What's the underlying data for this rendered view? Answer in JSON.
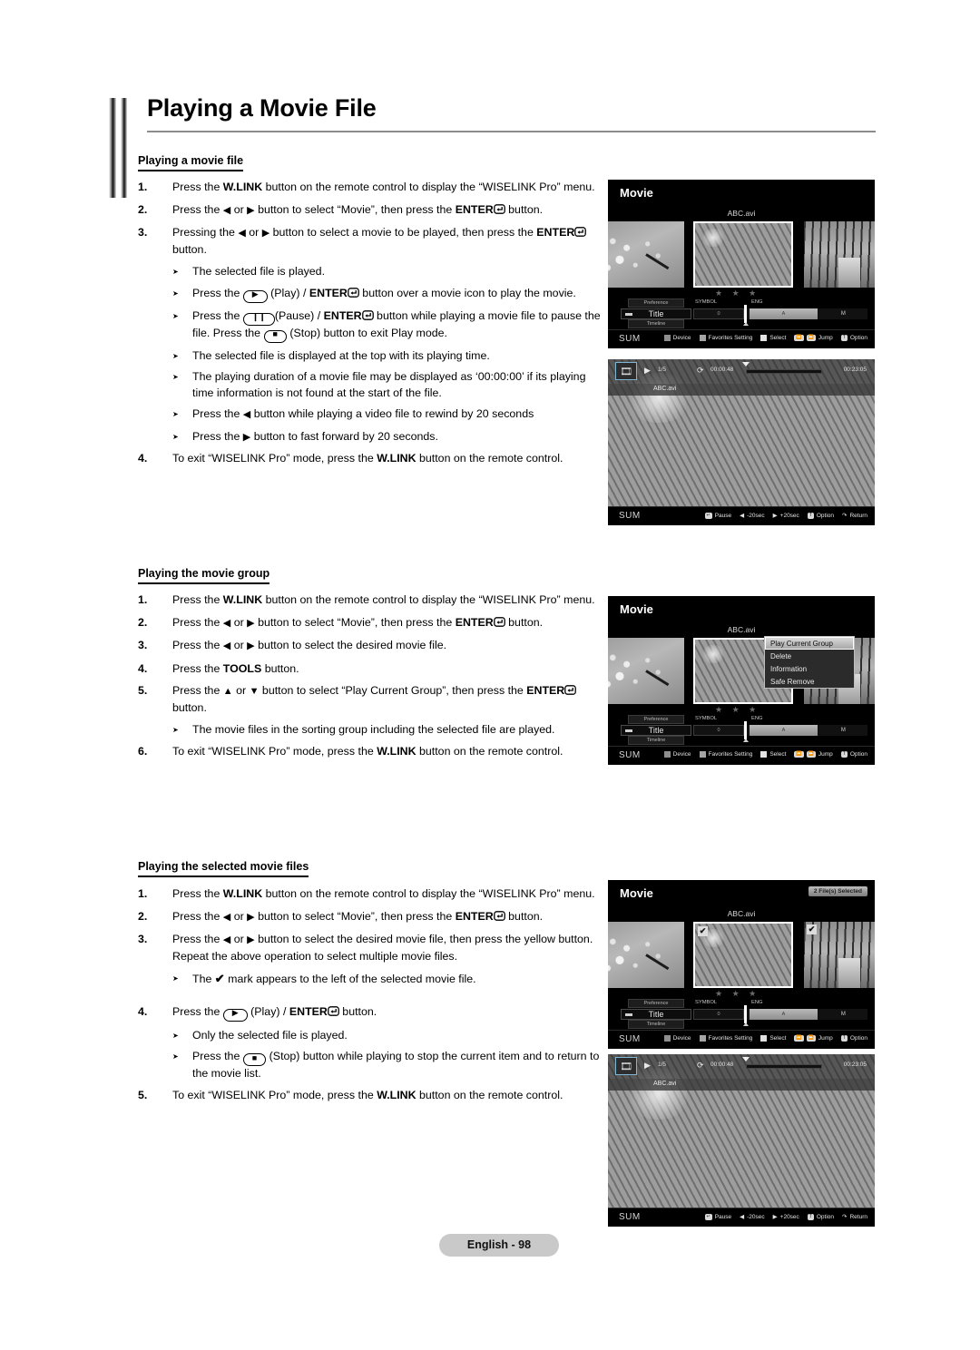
{
  "page": {
    "title": "Playing a Movie File",
    "footer_label": "English - 98"
  },
  "sections": [
    {
      "heading": "Playing a movie file",
      "steps": [
        {
          "num": "1.",
          "parts": [
            {
              "t": "Press the "
            },
            {
              "t": "W.LINK",
              "b": true
            },
            {
              "t": " button on the remote control to display the “WISELINK Pro” menu."
            }
          ]
        },
        {
          "num": "2.",
          "parts": [
            {
              "t": "Press the "
            },
            {
              "t": "◀",
              "tri": true
            },
            {
              "t": " or "
            },
            {
              "t": "▶",
              "tri": true
            },
            {
              "t": " button to select “Movie”, then press the "
            },
            {
              "t": "ENTER",
              "b": true
            },
            {
              "enter": true
            },
            {
              "t": " button."
            }
          ]
        },
        {
          "num": "3.",
          "parts": [
            {
              "t": "Pressing the "
            },
            {
              "t": "◀",
              "tri": true
            },
            {
              "t": " or "
            },
            {
              "t": "▶",
              "tri": true
            },
            {
              "t": " button to select a movie to be played, then press the "
            },
            {
              "t": "ENTER",
              "b": true
            },
            {
              "enter": true
            },
            {
              "t": " button."
            }
          ]
        },
        {
          "bullet": true,
          "parts": [
            {
              "t": "The selected file is played."
            }
          ]
        },
        {
          "bullet": true,
          "parts": [
            {
              "t": "Press the "
            },
            {
              "key": "▶"
            },
            {
              "t": " (Play) / "
            },
            {
              "t": "ENTER",
              "b": true
            },
            {
              "enter": true
            },
            {
              "t": " button over a movie icon to play the movie."
            }
          ]
        },
        {
          "bullet": true,
          "parts": [
            {
              "t": "Press the "
            },
            {
              "key": "‖"
            },
            {
              "t": "(Pause) / "
            },
            {
              "t": "ENTER",
              "b": true
            },
            {
              "enter": true
            },
            {
              "t": " button while playing a movie file to pause the file. Press the "
            },
            {
              "key": "■"
            },
            {
              "t": " (Stop) button to exit Play mode."
            }
          ]
        },
        {
          "bullet": true,
          "parts": [
            {
              "t": "The selected file is displayed at the top with its playing time."
            }
          ]
        },
        {
          "bullet": true,
          "parts": [
            {
              "t": "The playing duration of a movie file may be displayed as ‘00:00:00’ if its playing time information is not found at the start of the file."
            }
          ]
        },
        {
          "bullet": true,
          "parts": [
            {
              "t": "Press the "
            },
            {
              "t": "◀",
              "tri": true
            },
            {
              "t": " button while playing a video file to rewind by 20 seconds"
            }
          ]
        },
        {
          "bullet": true,
          "parts": [
            {
              "t": "Press the "
            },
            {
              "t": "▶",
              "tri": true
            },
            {
              "t": " button to fast forward by 20 seconds."
            }
          ]
        },
        {
          "num": "4.",
          "parts": [
            {
              "t": "To exit “WISELINK Pro” mode, press the "
            },
            {
              "t": "W.LINK",
              "b": true
            },
            {
              "t": " button on the remote control."
            }
          ]
        }
      ]
    },
    {
      "heading": "Playing the movie group",
      "steps": [
        {
          "num": "1.",
          "parts": [
            {
              "t": "Press the "
            },
            {
              "t": "W.LINK",
              "b": true
            },
            {
              "t": " button on the remote control to display the “WISELINK Pro” menu."
            }
          ]
        },
        {
          "num": "2.",
          "parts": [
            {
              "t": "Press the "
            },
            {
              "t": "◀",
              "tri": true
            },
            {
              "t": " or "
            },
            {
              "t": "▶",
              "tri": true
            },
            {
              "t": " button to select “Movie”, then press the "
            },
            {
              "t": "ENTER",
              "b": true
            },
            {
              "enter": true
            },
            {
              "t": " button."
            }
          ]
        },
        {
          "num": "3.",
          "parts": [
            {
              "t": "Press the "
            },
            {
              "t": "◀",
              "tri": true
            },
            {
              "t": " or "
            },
            {
              "t": "▶",
              "tri": true
            },
            {
              "t": " button to select the desired movie file."
            }
          ]
        },
        {
          "num": "4.",
          "parts": [
            {
              "t": "Press the "
            },
            {
              "t": "TOOLS",
              "b": true
            },
            {
              "t": " button."
            }
          ]
        },
        {
          "num": "5.",
          "parts": [
            {
              "t": "Press the "
            },
            {
              "t": "▲",
              "tri": true
            },
            {
              "t": " or "
            },
            {
              "t": "▼",
              "tri": true
            },
            {
              "t": " button to select “Play Current Group”, then press the "
            },
            {
              "t": "ENTER",
              "b": true
            },
            {
              "enter": true
            },
            {
              "t": " button."
            }
          ]
        },
        {
          "bullet": true,
          "parts": [
            {
              "t": "The movie files in the sorting group including the selected file are played."
            }
          ]
        },
        {
          "num": "6.",
          "parts": [
            {
              "t": "To exit “WISELINK Pro” mode, press the "
            },
            {
              "t": "W.LINK",
              "b": true
            },
            {
              "t": " button on the remote control."
            }
          ]
        }
      ]
    },
    {
      "heading": "Playing the selected movie files",
      "steps": [
        {
          "num": "1.",
          "parts": [
            {
              "t": "Press the "
            },
            {
              "t": "W.LINK",
              "b": true
            },
            {
              "t": " button on the remote control to display the “WISELINK Pro” menu."
            }
          ]
        },
        {
          "num": "2.",
          "parts": [
            {
              "t": "Press the "
            },
            {
              "t": "◀",
              "tri": true
            },
            {
              "t": " or "
            },
            {
              "t": "▶",
              "tri": true
            },
            {
              "t": " button to select “Movie”, then press the "
            },
            {
              "t": "ENTER",
              "b": true
            },
            {
              "enter": true
            },
            {
              "t": " button."
            }
          ]
        },
        {
          "num": "3.",
          "parts": [
            {
              "t": "Press the "
            },
            {
              "t": "◀",
              "tri": true
            },
            {
              "t": " or "
            },
            {
              "t": "▶",
              "tri": true
            },
            {
              "t": " button to select the desired movie file, then press the yellow button. Repeat the above operation to select multiple movie files."
            }
          ]
        },
        {
          "bullet": true,
          "parts": [
            {
              "t": "The "
            },
            {
              "t": "✔",
              "chk": true
            },
            {
              "t": " mark appears to the left of the selected movie file."
            }
          ]
        },
        {
          "num": "4.",
          "gap": true,
          "parts": [
            {
              "t": "Press the "
            },
            {
              "key": "▶"
            },
            {
              "t": " (Play) / "
            },
            {
              "t": "ENTER",
              "b": true
            },
            {
              "enter": true
            },
            {
              "t": "  button."
            }
          ]
        },
        {
          "bullet": true,
          "parts": [
            {
              "t": "Only the selected file is played."
            }
          ]
        },
        {
          "bullet": true,
          "parts": [
            {
              "t": "Press the "
            },
            {
              "key": "■"
            },
            {
              "t": " (Stop) button while playing to stop the current item and to return to the movie list."
            }
          ]
        },
        {
          "num": "5.",
          "parts": [
            {
              "t": "To exit “WISELINK Pro” mode, press the "
            },
            {
              "t": "W.LINK",
              "b": true
            },
            {
              "t": " button on the remote control."
            }
          ]
        }
      ]
    }
  ],
  "screens": {
    "browse": {
      "title": "Movie",
      "file_label": "ABC.avi",
      "stars": "★ ★ ★",
      "sort": {
        "preference": "Preference",
        "title": "Title",
        "timeline": "Timeline",
        "symbol_head": "SYMBOL",
        "eng_head": "ENG",
        "symbol_cell": "0",
        "alpha_a": "A",
        "alpha_m": "M"
      },
      "help": {
        "sum": "SUM",
        "device": "Device",
        "favorites": "Favorites Setting",
        "select": "Select",
        "jump": "Jump",
        "option": "Option",
        "jump_prev_icon": "⏪",
        "jump_next_icon": "⏩"
      }
    },
    "browse_menu": {
      "title": "Movie",
      "file_label": "ABC.avi",
      "menu_items": [
        "Play Current Group",
        "Delete",
        "Information",
        "Safe Remove"
      ]
    },
    "browse_selected": {
      "title": "Movie",
      "file_label": "ABC.avi",
      "selected_badge": "2 File(s) Selected",
      "check_glyph": "✔"
    },
    "playback": {
      "play_icon": "▶",
      "index": "1/5",
      "repeat_icon": "⟳",
      "elapsed": "00:00:48",
      "total": "00:23:05",
      "file_name": "ABC.avi",
      "help": {
        "sum": "SUM",
        "pause": "Pause",
        "rewind": "-20sec",
        "forward": "+20sec",
        "option": "Option",
        "return": "Return"
      }
    }
  }
}
